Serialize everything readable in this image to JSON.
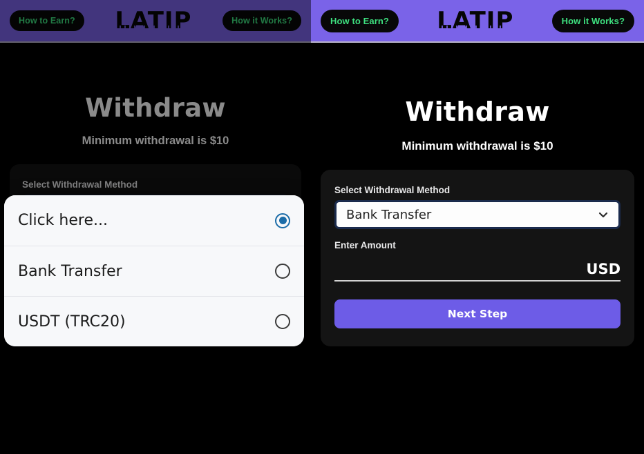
{
  "header": {
    "logo": "LATIP",
    "how_to_earn": "How to Earn?",
    "how_it_works": "How it Works?"
  },
  "left_panel": {
    "title": "Withdraw",
    "subtitle": "Minimum withdrawal is $10",
    "method_label": "Select Withdrawal Method",
    "method_value": "Click here...",
    "dropdown": {
      "open": true,
      "options": [
        {
          "label": "Click here...",
          "selected": true
        },
        {
          "label": "Bank Transfer",
          "selected": false
        },
        {
          "label": "USDT (TRC20)",
          "selected": false
        }
      ]
    }
  },
  "right_panel": {
    "title": "Withdraw",
    "subtitle": "Minimum withdrawal is $10",
    "method_label": "Select Withdrawal Method",
    "method_value": "Bank Transfer",
    "amount_label": "Enter Amount",
    "amount_value": "",
    "currency": "USD",
    "next_label": "Next Step"
  },
  "colors": {
    "header_purple": "#7a63e8",
    "pill_text_green": "#3ee07f",
    "button_purple": "#6d5ce7",
    "radio_blue": "#1b6ca8",
    "background": "#000000",
    "card": "#141414"
  }
}
